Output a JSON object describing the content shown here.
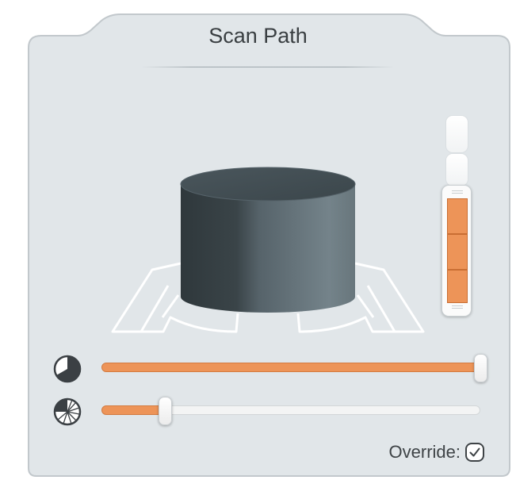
{
  "panel": {
    "title": "Scan Path"
  },
  "model": {
    "shape": "cylinder",
    "icon": "cylinder-model"
  },
  "layer_slider": {
    "icon": "layer-range-slider",
    "range_start_fraction": 0.0,
    "range_end_fraction": 1.0,
    "cells": 3
  },
  "sliders": [
    {
      "name": "coverage",
      "icon": "pie-chart-icon",
      "value_fraction": 1.0
    },
    {
      "name": "resolution",
      "icon": "segmented-pie-icon",
      "value_fraction": 0.17
    }
  ],
  "override": {
    "label": "Override:",
    "checked": true
  },
  "colors": {
    "accent": "#ed9458",
    "panel_bg": "#e1e6e9",
    "cylinder": "#4c585e"
  }
}
